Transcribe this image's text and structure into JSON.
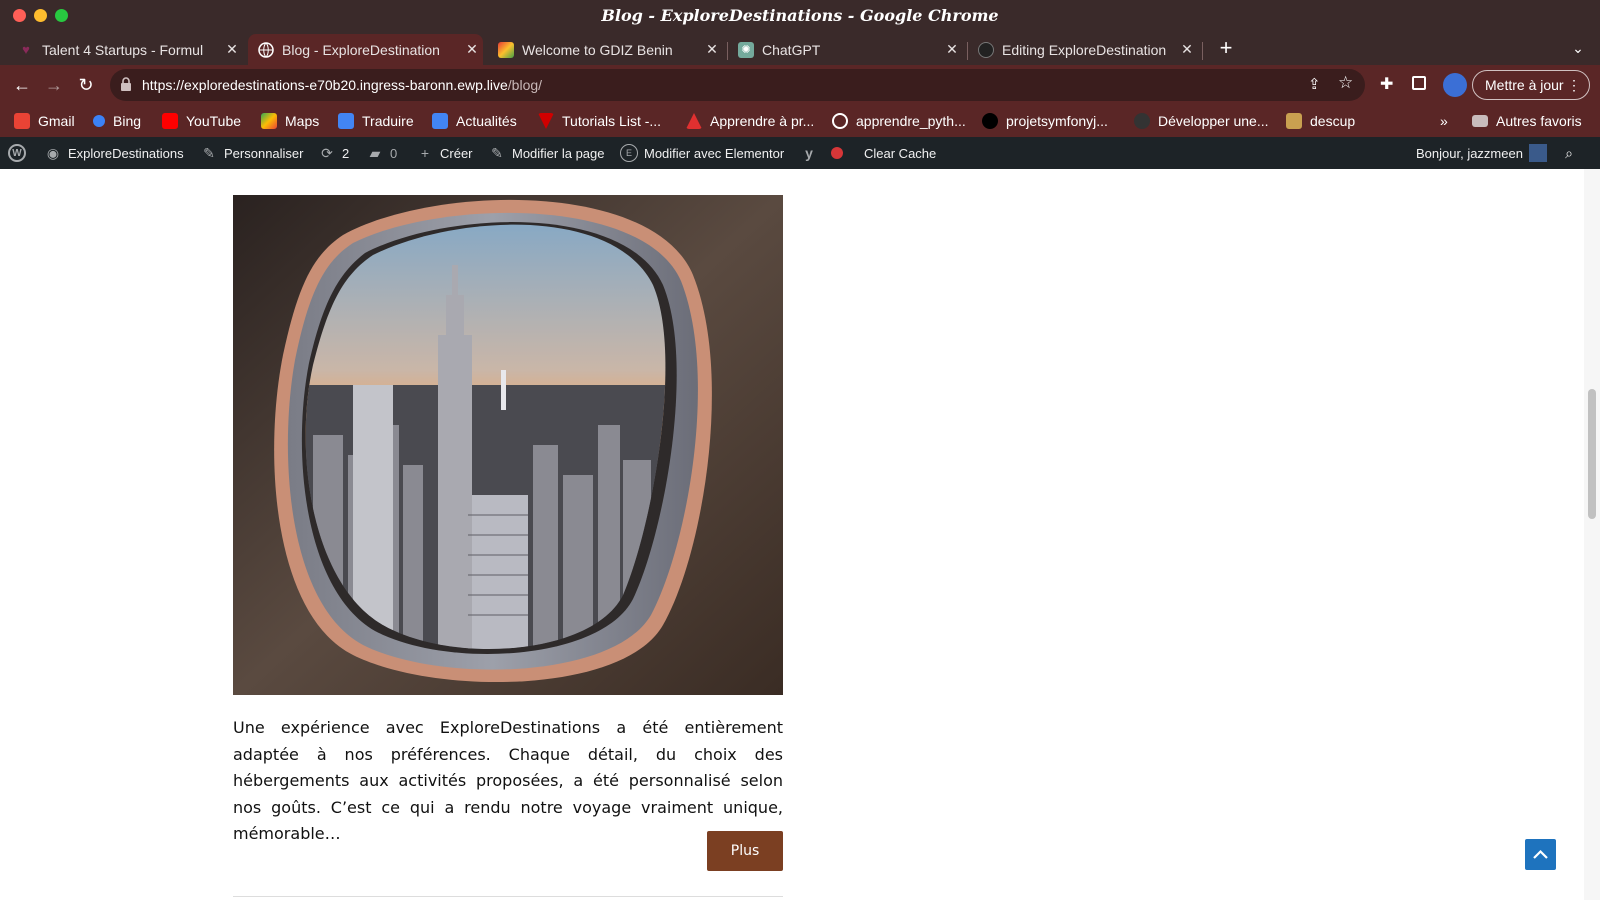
{
  "window": {
    "title": "Blog - ExploreDestinations - Google Chrome",
    "traffic_colors": [
      "#ff5f57",
      "#febc2e",
      "#28c840"
    ]
  },
  "tabs": [
    {
      "label": "Talent 4 Startups - Formul",
      "icon": "heart-icon",
      "active": false
    },
    {
      "label": "Blog - ExploreDestination",
      "icon": "globe-icon",
      "active": true
    },
    {
      "label": "Welcome to GDIZ Benin",
      "icon": "gdiz-logo-icon",
      "active": false
    },
    {
      "label": "ChatGPT",
      "icon": "chatgpt-icon",
      "active": false
    },
    {
      "label": "Editing ExploreDestination",
      "icon": "github-icon",
      "active": false
    }
  ],
  "toolbar": {
    "url_host": "https://exploredestinations-e70b20.ingress-baronn.ewp.live",
    "url_path": "/blog/",
    "update_label": "Mettre à jour"
  },
  "bookmarks": [
    {
      "label": "Gmail",
      "icon": "gmail-icon",
      "color": "#ea4335"
    },
    {
      "label": "Bing",
      "icon": "bing-search-icon",
      "color": "#3b82f6"
    },
    {
      "label": "YouTube",
      "icon": "youtube-icon",
      "color": "#ff0000"
    },
    {
      "label": "Maps",
      "icon": "maps-icon",
      "color": "#34a853"
    },
    {
      "label": "Traduire",
      "icon": "translate-icon",
      "color": "#4285f4"
    },
    {
      "label": "Actualités",
      "icon": "news-icon",
      "color": "#4285f4"
    },
    {
      "label": "Tutorials List -...",
      "icon": "tutorials-icon",
      "color": "#d00000"
    },
    {
      "label": "Apprendre à pr...",
      "icon": "learn-icon",
      "color": "#e03030"
    },
    {
      "label": "apprendre_pyth...",
      "icon": "globe-icon",
      "color": "#ffffff"
    },
    {
      "label": "projetsymfonyj...",
      "icon": "symfony-icon",
      "color": "#000000"
    },
    {
      "label": "Développer une...",
      "icon": "develop-icon",
      "color": "#333333"
    },
    {
      "label": "descup",
      "icon": "descup-icon",
      "color": "#c9a050"
    }
  ],
  "bookmarks_more": "»",
  "other_bookmarks": "Autres favoris",
  "wpbar": {
    "site_name": "ExploreDestinations",
    "customize": "Personnaliser",
    "updates_count": "2",
    "comments_count": "0",
    "create": "Créer",
    "edit_page": "Modifier la page",
    "edit_elementor": "Modifier avec Elementor",
    "clear_cache": "Clear Cache",
    "greeting": "Bonjour, jazzmeen"
  },
  "post": {
    "image_alt": "City skyline seen through airplane window",
    "excerpt": "Une expérience avec ExploreDestinations a été entièrement adaptée à nos préférences. Chaque détail, du choix des hébergements aux activités proposées, a été personnalisé selon nos goûts. C’est ce qui a rendu notre voyage vraiment unique, mémorable…",
    "more_label": "Plus"
  },
  "colors": {
    "chrome_dark": "#3a2a2a",
    "chrome_toolbar": "#5a2626",
    "wp_bar": "#1d2327",
    "button_brown": "#7b3f22",
    "scroll_top_blue": "#1e73be"
  }
}
